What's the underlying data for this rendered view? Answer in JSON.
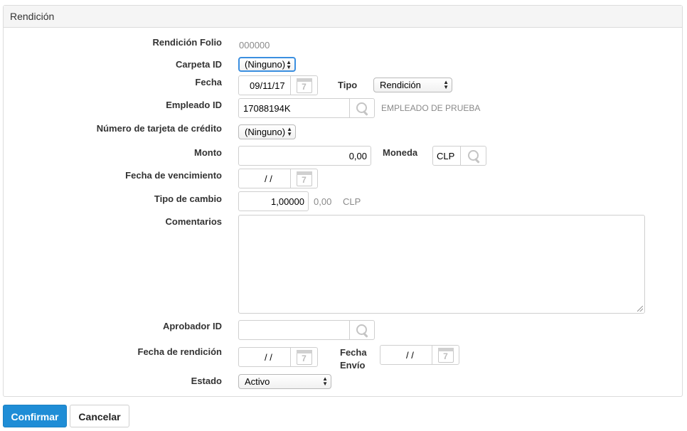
{
  "panel": {
    "title": "Rendición"
  },
  "fields": {
    "folio": {
      "label": "Rendición Folio",
      "value": "000000"
    },
    "carpeta": {
      "label": "Carpeta ID",
      "value": "(Ninguno)"
    },
    "fecha": {
      "label": "Fecha",
      "value": "09/11/17",
      "cal_day": "7"
    },
    "tipo": {
      "label": "Tipo",
      "value": "Rendición"
    },
    "empleado": {
      "label": "Empleado ID",
      "value": "17088194K",
      "name": "EMPLEADO DE PRUEBA"
    },
    "tarjeta": {
      "label": "Número de tarjeta de crédito",
      "value": "(Ninguno)"
    },
    "monto": {
      "label": "Monto",
      "value": "0,00"
    },
    "moneda": {
      "label": "Moneda",
      "value": "CLP"
    },
    "vencimiento": {
      "label": "Fecha de vencimiento",
      "value": "/ /",
      "cal_day": "7"
    },
    "tipo_cambio": {
      "label": "Tipo de cambio",
      "value": "1,00000",
      "converted": "0,00",
      "currency": "CLP"
    },
    "comentarios": {
      "label": "Comentarios",
      "value": ""
    },
    "aprobador": {
      "label": "Aprobador ID",
      "value": ""
    },
    "fecha_rendicion": {
      "label": "Fecha de rendición",
      "value": "/ /",
      "cal_day": "7"
    },
    "fecha_envio": {
      "label_line1": "Fecha",
      "label_line2": "Envío",
      "value": "/ /",
      "cal_day": "7"
    },
    "estado": {
      "label": "Estado",
      "value": "Activo"
    }
  },
  "buttons": {
    "confirm": "Confirmar",
    "cancel": "Cancelar"
  },
  "icons": {
    "calendar": "calendar-icon",
    "search": "search-icon",
    "select": "updown-arrows-icon"
  },
  "colors": {
    "primary": "#1f8dd6",
    "focus": "#3b8fe0"
  }
}
